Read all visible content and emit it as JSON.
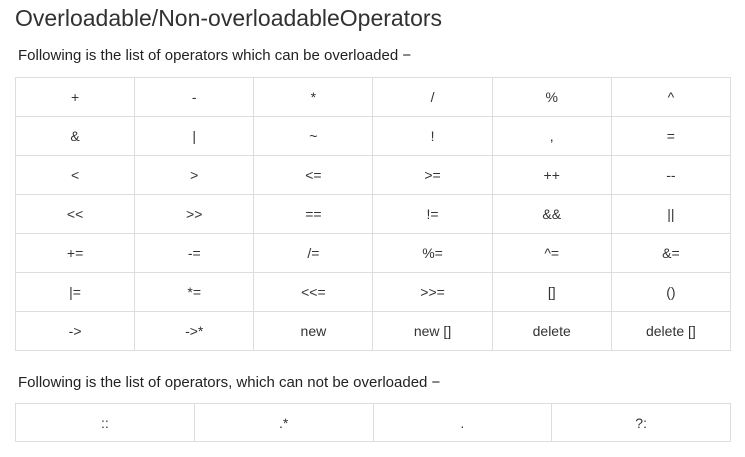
{
  "title": "Overloadable/Non-overloadableOperators",
  "overloadable_intro": "Following is the list of operators which can be overloaded −",
  "overloadable_rows": [
    [
      "+",
      "-",
      "*",
      "/",
      "%",
      "^"
    ],
    [
      "&",
      "|",
      "~",
      "!",
      ",",
      "="
    ],
    [
      "<",
      ">",
      "<=",
      ">=",
      "++",
      "--"
    ],
    [
      "<<",
      ">>",
      "==",
      "!=",
      "&&",
      "||"
    ],
    [
      "+=",
      "-=",
      "/=",
      "%=",
      "^=",
      "&="
    ],
    [
      "|=",
      "*=",
      "<<=",
      ">>=",
      "[]",
      "()"
    ],
    [
      "->",
      "->*",
      "new",
      "new []",
      "delete",
      "delete []"
    ]
  ],
  "non_overloadable_intro": "Following is the list of operators, which can not be overloaded −",
  "non_overloadable_rows": [
    [
      "::",
      ".*",
      ".",
      "?:"
    ]
  ]
}
